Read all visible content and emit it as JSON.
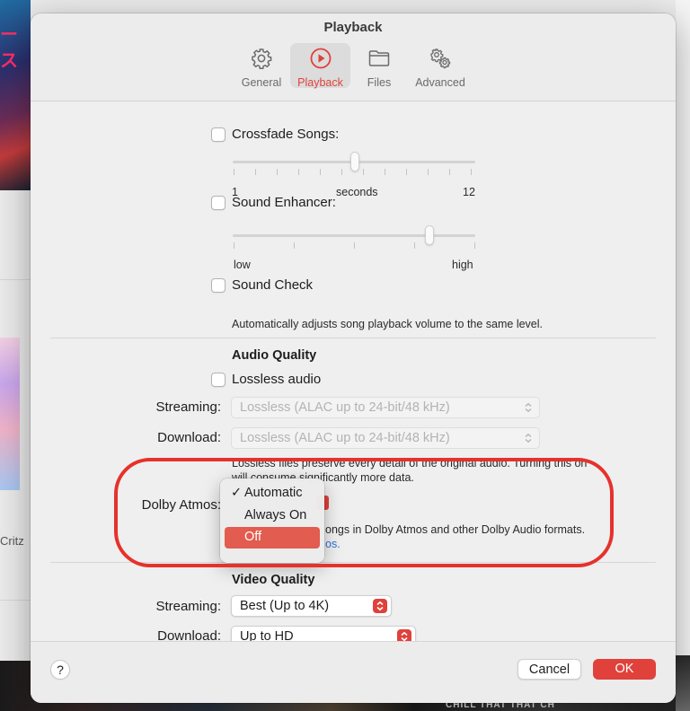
{
  "window": {
    "title": "Playback"
  },
  "tabs": [
    {
      "label": "General",
      "icon": "gear-icon",
      "active": false
    },
    {
      "label": "Playback",
      "icon": "play-circle-icon",
      "active": true
    },
    {
      "label": "Files",
      "icon": "folder-icon",
      "active": false
    },
    {
      "label": "Advanced",
      "icon": "gears-icon",
      "active": false
    }
  ],
  "crossfade": {
    "label": "Crossfade Songs:",
    "checked": false,
    "slider_min_label": "1",
    "slider_mid_label": "seconds",
    "slider_max_label": "12",
    "slider_value": 7
  },
  "sound_enhancer": {
    "label": "Sound Enhancer:",
    "checked": false,
    "low_label": "low",
    "high_label": "high",
    "slider_value": 0.8
  },
  "sound_check": {
    "label": "Sound Check",
    "checked": false,
    "description": "Automatically adjusts song playback volume to the same level."
  },
  "audio_quality": {
    "heading": "Audio Quality",
    "lossless_label": "Lossless audio",
    "lossless_checked": false,
    "streaming_label": "Streaming:",
    "streaming_value": "Lossless (ALAC up to 24-bit/48 kHz)",
    "download_label": "Download:",
    "download_value": "Lossless (ALAC up to 24-bit/48 kHz)",
    "note_line1": "Lossless files preserve every detail of the original audio. Turning this on",
    "note_line2": "will consume significantly more data.",
    "dolby_label": "Dolby Atmos:",
    "dolby_desc_visible": "ongs in Dolby Atmos and other Dolby Audio formats.",
    "dolby_link_visible": "os.",
    "dolby_options": [
      "Automatic",
      "Always On",
      "Off"
    ],
    "dolby_checked_option": "Automatic",
    "dolby_highlighted_option": "Off"
  },
  "video_quality": {
    "heading": "Video Quality",
    "streaming_label": "Streaming:",
    "streaming_value": "Best (Up to 4K)",
    "download_label": "Download:",
    "download_value": "Up to HD"
  },
  "footer": {
    "help_label": "?",
    "cancel_label": "Cancel",
    "ok_label": "OK"
  },
  "background": {
    "artist_fragment": "Critz",
    "art_text_top": "ース",
    "strip_text": "CHILL THAT    THAT CH"
  },
  "colors": {
    "accent": "#e0413b",
    "annotation_ring": "#e5322b",
    "link": "#2f6fd6"
  }
}
